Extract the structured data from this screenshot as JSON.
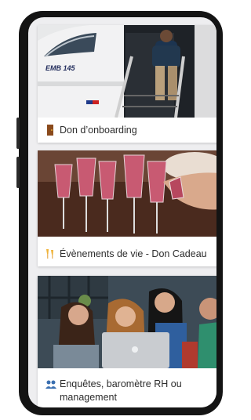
{
  "cards": [
    {
      "label": "Don d’onboarding",
      "icon": "door-icon",
      "image": "airplane-boarding-photo",
      "plane_text": "EMB 145"
    },
    {
      "label": "Évènements de vie - Don Cadeau",
      "icon": "champagne-glasses-icon",
      "image": "toast-glasses-photo"
    },
    {
      "label": "Enquêtes, baromètre RH ou management",
      "icon": "people-icon",
      "image": "team-laptop-photo"
    }
  ],
  "colors": {
    "screen_bg": "#eeeef0",
    "frame": "#141414",
    "card_bg": "#ffffff",
    "text": "#2d2d2d"
  }
}
